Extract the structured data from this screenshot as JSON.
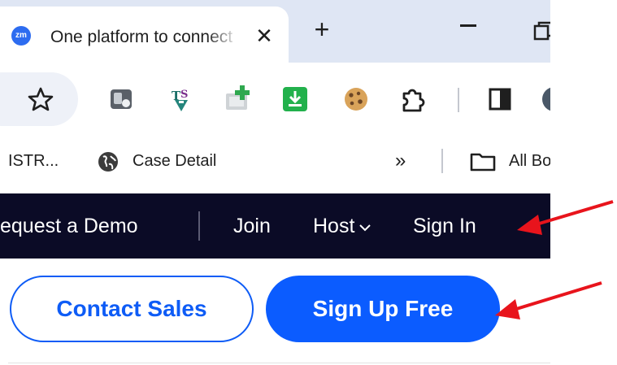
{
  "browser": {
    "tab": {
      "favicon_text": "zm",
      "title": "One platform to connect",
      "close_glyph": "✕"
    },
    "new_tab_glyph": "+",
    "toolbar_icons": [
      "star-icon",
      "extension-icon",
      "tds-extension-icon",
      "add-photo-extension-icon",
      "download-extension-icon",
      "cookie-extension-icon",
      "extensions-puzzle-icon",
      "side-panel-icon",
      "profile-avatar-icon"
    ],
    "bookmarks": {
      "items": [
        {
          "label": "ISTR..."
        },
        {
          "label": "Case Detail",
          "icon": "globe-icon"
        }
      ],
      "overflow_glyph": "»",
      "all_bookmarks_label": "All Bo"
    }
  },
  "site_nav": {
    "request_demo": "equest a Demo",
    "join": "Join",
    "host": "Host",
    "sign_in": "Sign In"
  },
  "cta": {
    "contact_sales": "Contact Sales",
    "sign_up_free": "Sign Up Free"
  },
  "colors": {
    "nav_bg": "#0b0b26",
    "brand_blue": "#0b5cff",
    "annotation_red": "#e8141c"
  }
}
